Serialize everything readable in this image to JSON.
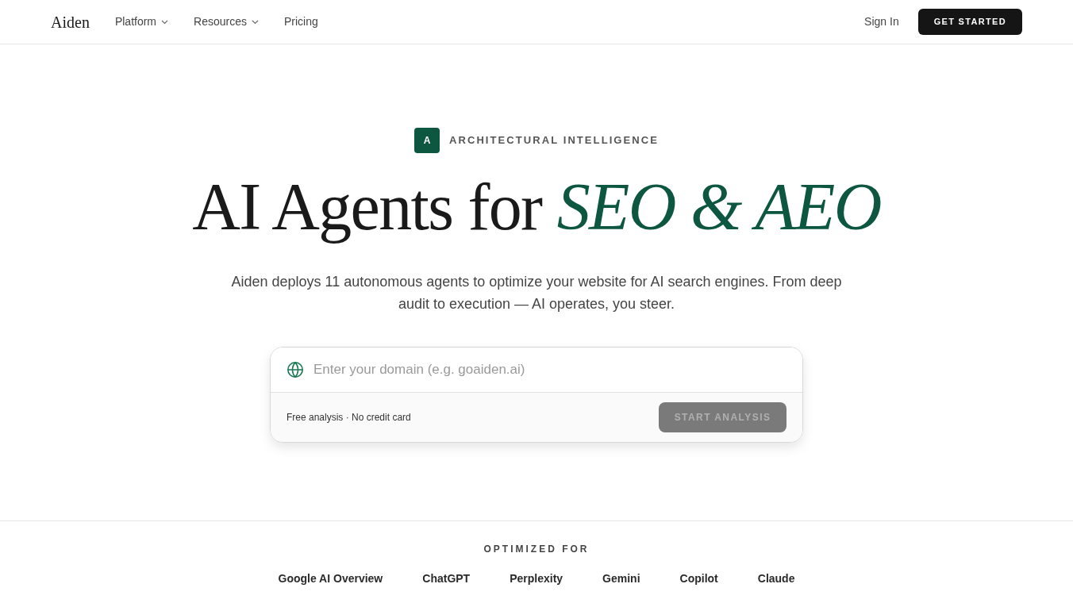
{
  "nav": {
    "logo": "Aiden",
    "items": [
      {
        "label": "Platform",
        "has_menu": true
      },
      {
        "label": "Resources",
        "has_menu": true
      },
      {
        "label": "Pricing",
        "has_menu": false
      }
    ],
    "sign_in": "Sign In",
    "cta": "GET STARTED"
  },
  "hero": {
    "badge_letter": "A",
    "badge_text": "ARCHITECTURAL INTELLIGENCE",
    "title_plain": "AI Agents for",
    "title_accent": "SEO & AEO",
    "subtitle": "Aiden deploys 11 autonomous agents to optimize your website for AI search engines. From deep audit to execution — AI operates, you steer."
  },
  "form": {
    "placeholder": "Enter your domain (e.g. goaiden.ai)",
    "note": "Free analysis · No credit card",
    "button": {
      "label": "START ANALYSIS",
      "disabled": true
    }
  },
  "optimized": {
    "heading": "OPTIMIZED FOR",
    "platforms": [
      "Google AI Overview",
      "ChatGPT",
      "Perplexity",
      "Gemini",
      "Copilot",
      "Claude"
    ]
  }
}
